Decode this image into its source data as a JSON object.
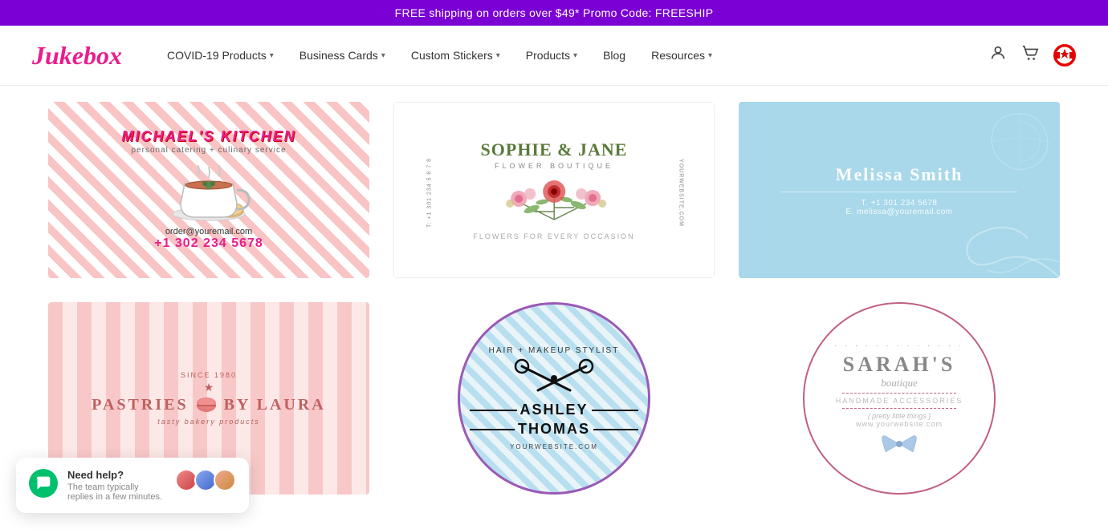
{
  "announcement": {
    "text": "FREE shipping on orders over $49* Promo Code: FREESHIP"
  },
  "nav": {
    "logo": "Jukebox",
    "items": [
      {
        "label": "COVID-19 Products",
        "has_dropdown": true
      },
      {
        "label": "Business Cards",
        "has_dropdown": true
      },
      {
        "label": "Custom Stickers",
        "has_dropdown": true
      },
      {
        "label": "Products",
        "has_dropdown": true
      },
      {
        "label": "Blog",
        "has_dropdown": false
      },
      {
        "label": "Resources",
        "has_dropdown": true
      }
    ]
  },
  "cards": [
    {
      "id": "michaels-kitchen",
      "title": "MICHAEL'S KITCHEN",
      "subtitle": "personal catering + culinary service",
      "email": "order@youremail.com",
      "phone": "+1 302 234 5678"
    },
    {
      "id": "sophie-jane",
      "title": "SOPHIE & JANE",
      "subtitle": "FLOWER BOUTIQUE",
      "tagline": "FLOWERS FOR EVERY OCCASION",
      "phone": "T: +1 301 234 5678",
      "website": "YOURWEBSITE.COM"
    },
    {
      "id": "melissa-smith",
      "name": "Melissa Smith",
      "phone": "T. +1 301 234 5678",
      "email": "E. melissa@youremail.com"
    },
    {
      "id": "pastries-laura",
      "since": "SINCE 1980",
      "title": "PASTRIES  BY LAURA",
      "tagline": "tasty bakery products"
    },
    {
      "id": "ashley-thomas",
      "profession": "HAIR + MAKEUP STYLIST",
      "name": "ASHLEY  THOMAS",
      "website": "YOURWEBSITE.COM"
    },
    {
      "id": "sarahs-boutique",
      "name": "SARAH'S",
      "sub": "boutique",
      "tagline": "handmade accessories",
      "pretty": "{ pretty little things }",
      "website": "www.yourwebsite.com"
    }
  ],
  "chat": {
    "title": "Need help?",
    "subtitle": "The team typically replies in a few minutes."
  }
}
